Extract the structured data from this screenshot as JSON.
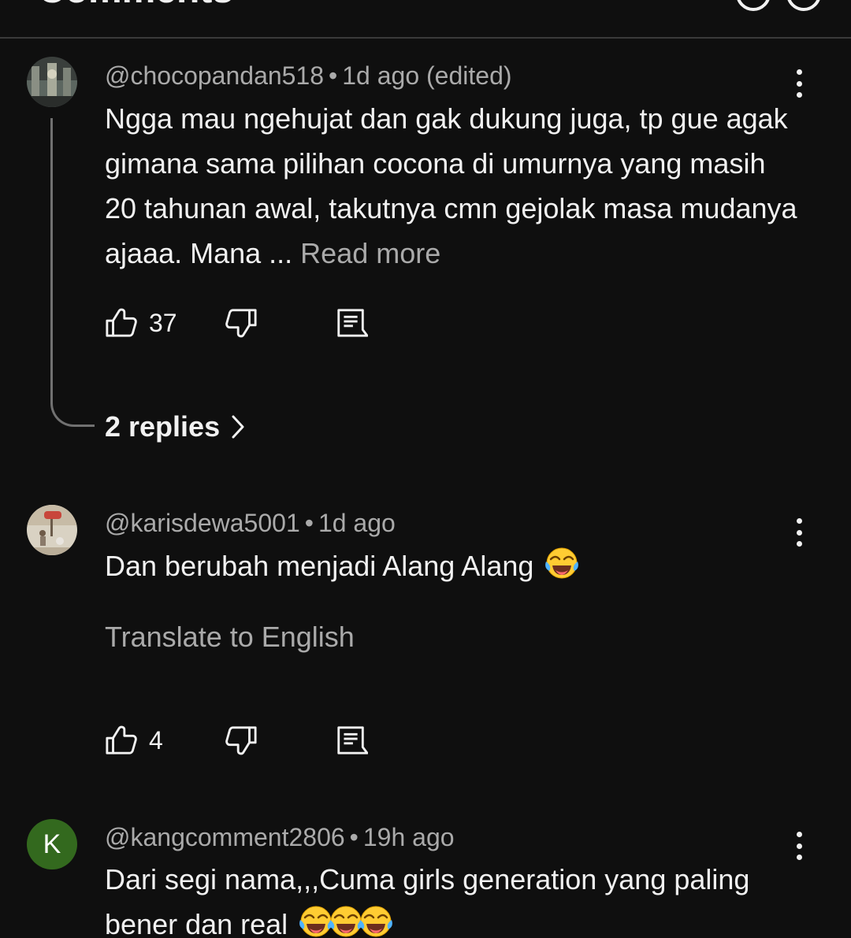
{
  "header": {
    "title": "Comments"
  },
  "comments": [
    {
      "handle": "@chocopandan518",
      "separator": "•",
      "time": "1d ago (edited)",
      "text": "Ngga mau ngehujat dan gak dukung juga, tp gue agak gimana sama pilihan cocona di umurnya yang masih 20 tahunan awal, takutnya cmn gejolak masa mudanya ajaaa. Mana ...",
      "read_more": "Read more",
      "likes": "37",
      "replies_label": "2 replies"
    },
    {
      "handle": "@karisdewa5001",
      "separator": "•",
      "time": "1d ago",
      "text": "Dan berubah menjadi Alang Alang",
      "emoji": "tears-of-joy-emoji",
      "translate_label": "Translate to English",
      "likes": "4"
    },
    {
      "handle": "@kangcomment2806",
      "separator": "•",
      "time": "19h ago",
      "avatar_letter": "K",
      "text_line1": "Dari segi nama,,,Cuma girls generation yang paling",
      "text_line2": "bener dan real",
      "emoji": "tears-of-joy-emoji",
      "emoji_count": 3
    }
  ],
  "icons": {
    "like": "thumb-up-icon",
    "dislike": "thumb-down-icon",
    "reply": "comment-reply-icon",
    "more": "more-vert-icon",
    "replies_arrow": "chevron-right-icon"
  },
  "colors": {
    "background": "#0f0f0f",
    "primary_text": "#f1f1f1",
    "secondary_text": "#aaaaaa",
    "avatar_green": "#33691e",
    "thread_line": "#717171"
  }
}
